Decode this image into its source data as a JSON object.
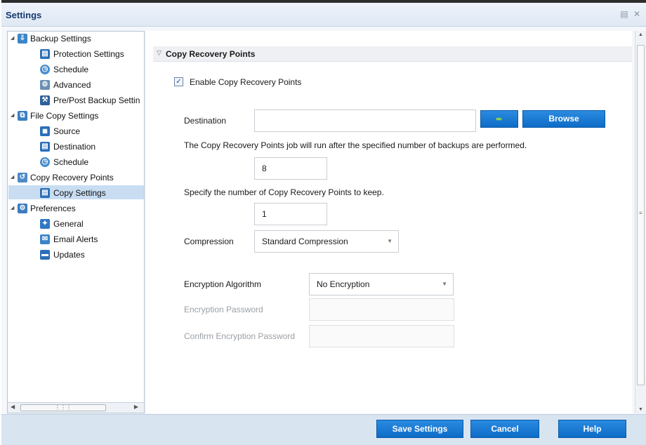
{
  "window": {
    "title": "Settings"
  },
  "tree": {
    "items": [
      {
        "label": "Backup Settings",
        "level": 0,
        "expanded": true,
        "icon": "backup-icon"
      },
      {
        "label": "Protection Settings",
        "level": 1,
        "icon": "protection-settings-icon"
      },
      {
        "label": "Schedule",
        "level": 1,
        "icon": "schedule-icon"
      },
      {
        "label": "Advanced",
        "level": 1,
        "icon": "advanced-icon"
      },
      {
        "label": "Pre/Post Backup Settin",
        "level": 1,
        "icon": "pre-post-backup-icon"
      },
      {
        "label": "File Copy Settings",
        "level": 0,
        "expanded": true,
        "icon": "file-copy-icon"
      },
      {
        "label": "Source",
        "level": 1,
        "icon": "source-icon"
      },
      {
        "label": "Destination",
        "level": 1,
        "icon": "destination-icon"
      },
      {
        "label": "Schedule",
        "level": 1,
        "icon": "schedule-icon"
      },
      {
        "label": "Copy Recovery Points",
        "level": 0,
        "expanded": true,
        "icon": "copy-recovery-points-icon"
      },
      {
        "label": "Copy Settings",
        "level": 1,
        "selected": true,
        "icon": "copy-settings-icon"
      },
      {
        "label": "Preferences",
        "level": 0,
        "expanded": true,
        "icon": "preferences-icon"
      },
      {
        "label": "General",
        "level": 1,
        "icon": "general-icon"
      },
      {
        "label": "Email Alerts",
        "level": 1,
        "icon": "email-alerts-icon"
      },
      {
        "label": "Updates",
        "level": 1,
        "icon": "updates-icon"
      }
    ]
  },
  "content": {
    "section_title": "Copy Recovery Points",
    "enable_checkbox": {
      "label": "Enable Copy Recovery Points",
      "checked": true
    },
    "destination": {
      "label": "Destination",
      "value": "",
      "browse_label": "Browse"
    },
    "backups_info": "The Copy Recovery Points job will run after the specified number of backups are performed.",
    "backups_count": "8",
    "keep_info": "Specify the number of Copy Recovery Points to keep.",
    "keep_count": "1",
    "compression": {
      "label": "Compression",
      "value": "Standard Compression"
    },
    "encryption_algorithm": {
      "label": "Encryption Algorithm",
      "value": "No Encryption"
    },
    "encryption_password": {
      "label": "Encryption Password",
      "value": ""
    },
    "confirm_password": {
      "label": "Confirm Encryption Password",
      "value": ""
    }
  },
  "footer": {
    "save_label": "Save Settings",
    "cancel_label": "Cancel",
    "help_label": "Help"
  },
  "colors": {
    "accent_button": "#1277d3",
    "selection": "#c8ddf2",
    "footer_bg": "#d9e4f1"
  }
}
